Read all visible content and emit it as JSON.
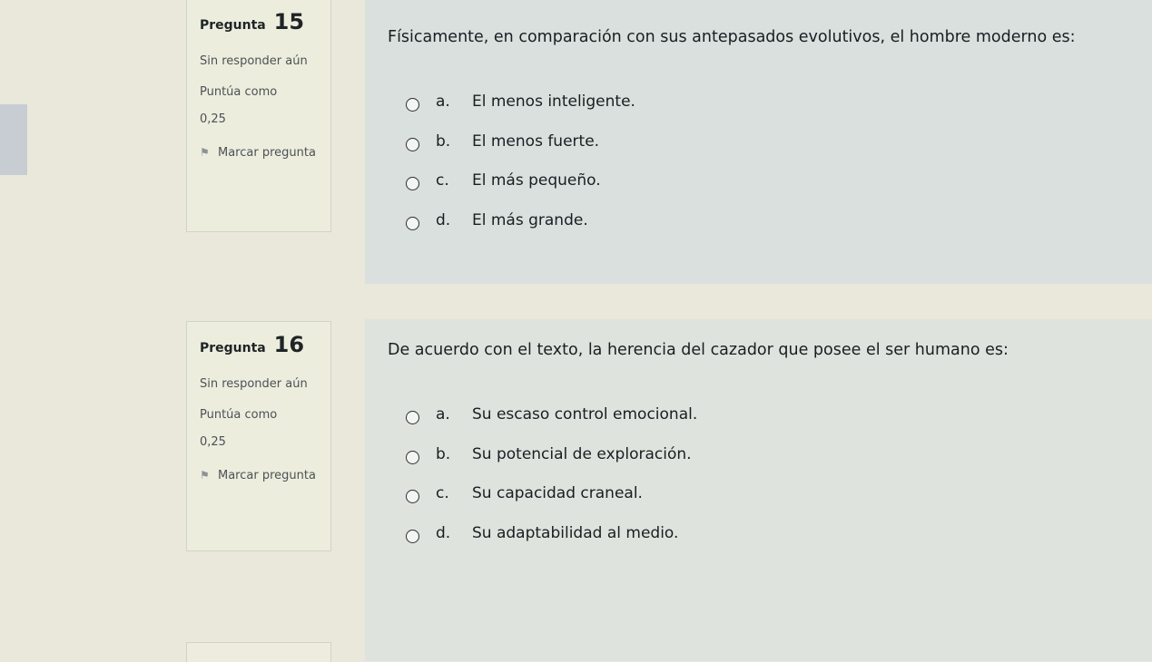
{
  "q15": {
    "label": "Pregunta",
    "number": "15",
    "state": "Sin responder aún",
    "grade_label": "Puntúa como",
    "grade_value": "0,25",
    "flag_label": "Marcar pregunta",
    "text": "Físicamente, en comparación con sus antepasados evolutivos, el hombre moderno es:",
    "answers": [
      {
        "letter": "a.",
        "text": "El menos inteligente."
      },
      {
        "letter": "b.",
        "text": "El menos fuerte."
      },
      {
        "letter": "c.",
        "text": "El más pequeño."
      },
      {
        "letter": "d.",
        "text": "El más grande."
      }
    ]
  },
  "q16": {
    "label": "Pregunta",
    "number": "16",
    "state": "Sin responder aún",
    "grade_label": "Puntúa como",
    "grade_value": "0,25",
    "flag_label": "Marcar pregunta",
    "text": "De acuerdo con el texto, la herencia del cazador que posee el ser humano es:",
    "answers": [
      {
        "letter": "a.",
        "text": "Su escaso control emocional."
      },
      {
        "letter": "b.",
        "text": "Su potencial de exploración."
      },
      {
        "letter": "c.",
        "text": "Su capacidad craneal."
      },
      {
        "letter": "d.",
        "text": "Su adaptabilidad al medio."
      }
    ]
  },
  "icons": {
    "flag": "flag-icon",
    "radio": "radio-unselected"
  },
  "colors": {
    "page_background": "#e9e8da",
    "info_background": "#ededdd",
    "content_background": "#d9e0dd",
    "text": "#1a1e22",
    "muted_text": "#4b5256"
  }
}
